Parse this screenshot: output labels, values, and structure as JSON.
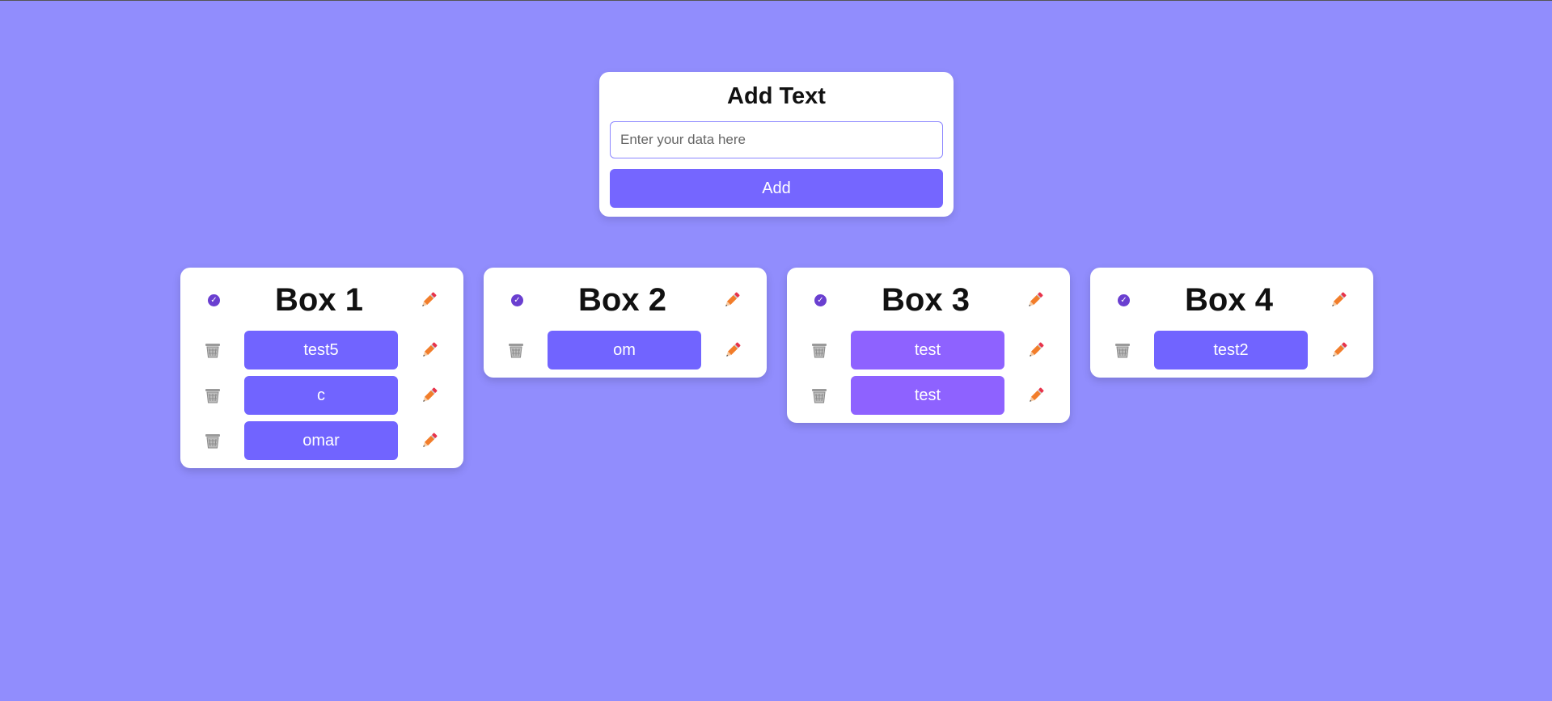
{
  "add_card": {
    "title": "Add Text",
    "input_placeholder": "Enter your data here",
    "input_value": "",
    "button_label": "Add"
  },
  "colors": {
    "background": "#918dfd",
    "accent": "#7566ff",
    "pill_blue": "#7164ff",
    "pill_violet": "#8e62ff",
    "check": "#6a3fd0",
    "pencil": "#f27d2a"
  },
  "boxes": [
    {
      "title": "Box 1",
      "header_icons": [
        "check-icon",
        "pencil-icon"
      ],
      "items": [
        {
          "label": "test5",
          "color": "pill_blue"
        },
        {
          "label": "c",
          "color": "pill_blue"
        },
        {
          "label": "omar",
          "color": "pill_blue"
        }
      ]
    },
    {
      "title": "Box 2",
      "header_icons": [
        "check-icon",
        "pencil-icon"
      ],
      "items": [
        {
          "label": "om",
          "color": "pill_blue"
        }
      ]
    },
    {
      "title": "Box 3",
      "header_icons": [
        "check-icon",
        "pencil-icon"
      ],
      "items": [
        {
          "label": "test",
          "color": "pill_violet"
        },
        {
          "label": "test",
          "color": "pill_violet"
        }
      ]
    },
    {
      "title": "Box 4",
      "header_icons": [
        "check-icon",
        "pencil-icon"
      ],
      "items": [
        {
          "label": "test2",
          "color": "pill_blue"
        }
      ]
    }
  ]
}
